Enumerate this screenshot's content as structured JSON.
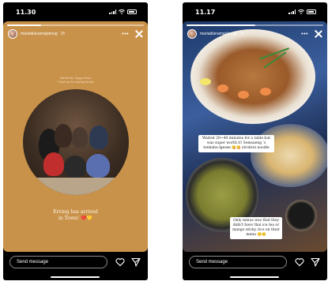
{
  "left_story": {
    "status_time": "11.30",
    "username": "mariadianamaplenug",
    "posted_ago": "2h",
    "progress_fraction": 0.25,
    "caption_top": "Old friends, Happy Hours\nThank you for sharing Kenny!",
    "caption_bottom": "Erving has arrived\nin Town! ❤️💛",
    "reply_placeholder": "Send message"
  },
  "right_story": {
    "status_time": "11.17",
    "username": "mariadianamaplenug",
    "posted_ago": "2h",
    "progress_fraction": 0.5,
    "note_1": "Waited 20~40 minutes for a table but was super worth it! Semsaeng ’s tenkahu-lgesee 😋😋 strokrei noodle",
    "note_2": "Only minus was that they didn't have thai ice tea or mango sticky rice on their menu 😔😔",
    "reply_placeholder": "Send message"
  },
  "colors": {
    "left_story_bg": "#c9924a",
    "right_story_bg": "#2a3548"
  }
}
